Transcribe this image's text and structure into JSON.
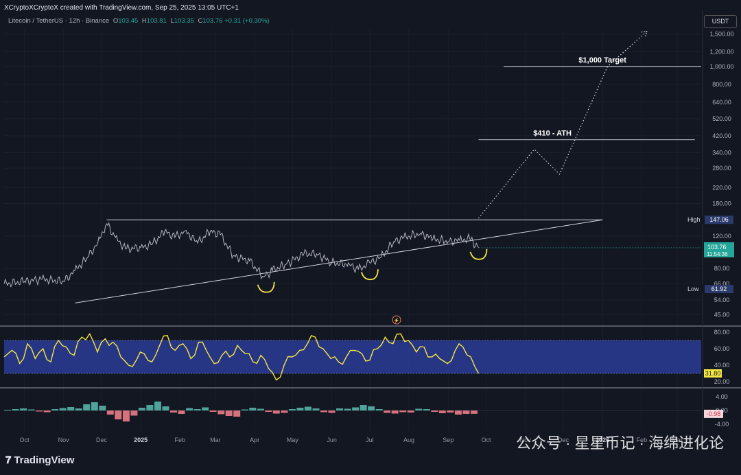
{
  "header": {
    "credit": "XCryptoXCryptoX created with TradingView.com, Sep 25, 2025 13:05 UTC+1",
    "symbol": "Litecoin / TetherUS · 12h · Binance",
    "ohlc": {
      "o_label": "O",
      "o": "103.45",
      "h_label": "H",
      "h": "103.81",
      "l_label": "L",
      "l": "103.35",
      "c_label": "C",
      "c": "103.76",
      "change": "+0.31 (+0.30%)"
    }
  },
  "currency_badge": "USDT",
  "logo_text": "TradingView",
  "watermark": "公众号 · 星星币记 · 海绵进化论",
  "colors": {
    "background": "#131722",
    "price_line": "#b2b5be",
    "rsi_line": "#f5e642",
    "rsi_band": "#2a3a8f",
    "macd_up": "#4fa39b",
    "macd_down": "#d4727d",
    "last_price_badge": "#26a69a",
    "high_low_badge": "#2a3a6b",
    "annotation": "#f5e642"
  },
  "chart_data": [
    {
      "type": "line",
      "name_hidden": true,
      "y_scale": "log",
      "ylim": [
        40,
        1600
      ],
      "x_range": [
        "2024-09-15",
        "2026-03-20"
      ],
      "x_ticks": [
        "Oct",
        "Nov",
        "Dec",
        "2025",
        "Feb",
        "Mar",
        "Apr",
        "May",
        "Jun",
        "Jul",
        "Aug",
        "Sep",
        "Oct",
        "Nov",
        "Dec",
        "2026",
        "Feb",
        "Mar"
      ],
      "y_ticks": [
        "1,500.00",
        "1,200.00",
        "1,000.00",
        "800.00",
        "640.00",
        "520.00",
        "420.00",
        "340.00",
        "280.00",
        "220.00",
        "180.00",
        "120.00",
        "80.00",
        "66.00",
        "54.00",
        "45.00"
      ],
      "series_points": [
        [
          "2024-09-15",
          66
        ],
        [
          "2024-10-01",
          68
        ],
        [
          "2024-10-15",
          70
        ],
        [
          "2024-11-01",
          68
        ],
        [
          "2024-11-10",
          78
        ],
        [
          "2024-11-20",
          92
        ],
        [
          "2024-11-28",
          110
        ],
        [
          "2024-12-05",
          140
        ],
        [
          "2024-12-12",
          118
        ],
        [
          "2024-12-20",
          102
        ],
        [
          "2025-01-01",
          104
        ],
        [
          "2025-01-10",
          108
        ],
        [
          "2025-01-20",
          128
        ],
        [
          "2025-01-28",
          118
        ],
        [
          "2025-02-05",
          128
        ],
        [
          "2025-02-15",
          110
        ],
        [
          "2025-02-25",
          128
        ],
        [
          "2025-03-05",
          122
        ],
        [
          "2025-03-15",
          94
        ],
        [
          "2025-03-28",
          88
        ],
        [
          "2025-04-08",
          72
        ],
        [
          "2025-04-15",
          78
        ],
        [
          "2025-04-25",
          84
        ],
        [
          "2025-05-10",
          96
        ],
        [
          "2025-05-20",
          96
        ],
        [
          "2025-06-01",
          86
        ],
        [
          "2025-06-15",
          84
        ],
        [
          "2025-06-22",
          79
        ],
        [
          "2025-07-01",
          86
        ],
        [
          "2025-07-10",
          92
        ],
        [
          "2025-07-20",
          112
        ],
        [
          "2025-07-28",
          118
        ],
        [
          "2025-08-10",
          124
        ],
        [
          "2025-08-20",
          116
        ],
        [
          "2025-09-01",
          112
        ],
        [
          "2025-09-10",
          114
        ],
        [
          "2025-09-18",
          116
        ],
        [
          "2025-09-25",
          103.76
        ]
      ],
      "projection_points": [
        [
          "2025-09-25",
          150
        ],
        [
          "2025-11-08",
          355
        ],
        [
          "2025-11-28",
          260
        ],
        [
          "2026-01-05",
          1000
        ],
        [
          "2026-02-05",
          1550
        ]
      ],
      "resistance_line": {
        "price": 147.06,
        "from": "2024-12-05",
        "to": "2026-01-01"
      },
      "support_line": {
        "from": [
          "2024-11-10",
          52
        ],
        "to": [
          "2026-01-01",
          147
        ]
      },
      "levels": [
        {
          "label": "$1,000 Target",
          "price": 1000,
          "from": "2025-10-15",
          "to": "2026-04-10"
        },
        {
          "label": "$410 - ATH",
          "price": 400,
          "from": "2025-09-25",
          "to": "2026-03-15"
        }
      ],
      "marks": [
        {
          "label": "High",
          "value": "147.06",
          "price": 147.06
        },
        {
          "label": "Low",
          "value": "61.92",
          "price": 61.92
        }
      ],
      "last_price": {
        "value": "103.76",
        "countdown": "11:54:36",
        "price": 103.76
      },
      "bottoms": [
        [
          "2025-04-10",
          61
        ],
        [
          "2025-07-01",
          71.5
        ],
        [
          "2025-09-25",
          92
        ]
      ]
    },
    {
      "type": "line",
      "panel": "RSI",
      "ylim": [
        15,
        85
      ],
      "y_ticks": [
        "80.00",
        "60.00",
        "40.00",
        "20.00"
      ],
      "band": [
        30,
        70
      ],
      "last_value": "31.80",
      "values": [
        50,
        58,
        42,
        66,
        48,
        60,
        44,
        70,
        62,
        52,
        74,
        78,
        56,
        72,
        68,
        50,
        40,
        46,
        54,
        44,
        64,
        76,
        58,
        66,
        48,
        68,
        58,
        42,
        52,
        50,
        64,
        54,
        44,
        52,
        36,
        22,
        40,
        50,
        58,
        66,
        74,
        60,
        48,
        44,
        50,
        58,
        54,
        46,
        60,
        74,
        66,
        78,
        70,
        56,
        62,
        50,
        48,
        42,
        58,
        62,
        50,
        30
      ]
    },
    {
      "type": "bar",
      "panel": "MACD",
      "ylim": [
        -6,
        6
      ],
      "y_ticks": [
        "4.00",
        "0.00",
        "-4.00"
      ],
      "last_value": "-0.98",
      "values": [
        0.2,
        0.4,
        0.6,
        0.3,
        -0.3,
        -0.5,
        0.4,
        0.7,
        1.0,
        0.6,
        1.8,
        2.4,
        1.4,
        -1.2,
        -2.6,
        -3.2,
        -1.5,
        0.8,
        1.6,
        2.6,
        1.2,
        -0.6,
        -1.0,
        0.7,
        0.4,
        0.9,
        -0.4,
        -1.1,
        -1.6,
        -1.8,
        0.3,
        0.8,
        0.5,
        -0.4,
        -0.9,
        -0.7,
        0.4,
        0.8,
        1.1,
        0.6,
        -0.5,
        -0.7,
        0.6,
        0.5,
        0.9,
        1.6,
        1.2,
        0.4,
        -0.7,
        -0.9,
        -0.5,
        -0.6,
        0.5,
        0.4,
        -0.4,
        -0.8,
        -0.6,
        -1.2,
        -1.0,
        -0.98
      ]
    }
  ]
}
